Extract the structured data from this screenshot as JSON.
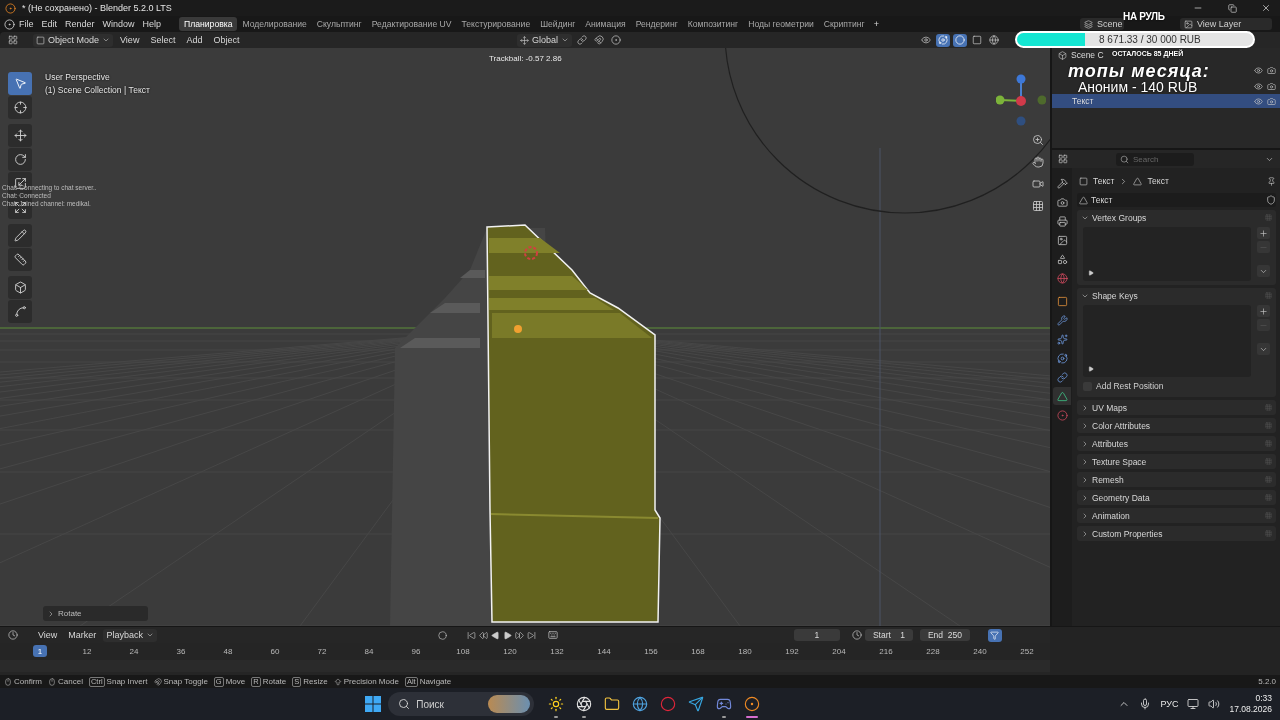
{
  "title_bar": {
    "title": "* (Не сохранено) - Blender 5.2.0 LTS"
  },
  "menu_bar": {
    "menus": [
      "File",
      "Edit",
      "Render",
      "Window",
      "Help"
    ],
    "workspaces": [
      {
        "label": "Планировка",
        "selected": true
      },
      {
        "label": "Моделирование",
        "selected": false
      },
      {
        "label": "Скульптинг",
        "selected": false
      },
      {
        "label": "Редактирование UV",
        "selected": false
      },
      {
        "label": "Текстурирование",
        "selected": false
      },
      {
        "label": "Шейдинг",
        "selected": false
      },
      {
        "label": "Анимация",
        "selected": false
      },
      {
        "label": "Рендеринг",
        "selected": false
      },
      {
        "label": "Композитинг",
        "selected": false
      },
      {
        "label": "Ноды геометрии",
        "selected": false
      },
      {
        "label": "Скриптинг",
        "selected": false
      }
    ],
    "add_tab": "+",
    "scene": "Scene",
    "view_layer": "View Layer"
  },
  "viewport_header": {
    "mode": "Object Mode",
    "menus": [
      "View",
      "Select",
      "Add",
      "Object"
    ],
    "orientation": "Global"
  },
  "viewport": {
    "tools": [
      {
        "kind": "select",
        "selected": true
      },
      {
        "kind": "cursor",
        "selected": false
      },
      {
        "kind": "move",
        "selected": false
      },
      {
        "kind": "rotate",
        "selected": false
      },
      {
        "kind": "scale",
        "selected": false
      },
      {
        "kind": "transform",
        "selected": false
      },
      {
        "kind": "annotate",
        "selected": false
      },
      {
        "kind": "measure",
        "selected": false
      },
      {
        "kind": "add-cube",
        "selected": false
      },
      {
        "kind": "curve",
        "selected": false
      }
    ],
    "view_name": "User Perspective",
    "collection_info": "(1) Scene Collection | Текст",
    "status": "Trackball: -0.57 2.86",
    "chat_log": [
      "Chat: Connecting to chat server..",
      "Chat: Connected",
      "Chat: Joined channel: medikal."
    ],
    "last_operator": "Rotate"
  },
  "outliner": {
    "header": "Scene C",
    "rows": [
      {
        "label": "Текст",
        "selected": true
      }
    ]
  },
  "stream_overlay": {
    "goal_title": "НА РУЛЬ",
    "goal_amount": "8 671.33 / 30 000 RUB",
    "level": 0.29,
    "days_left": "ОСТАЛОСЬ 85 ДНЕЙ",
    "top_title": "топы месяца:",
    "top_donor": "Аноним - 140 RUB"
  },
  "properties": {
    "search_placeholder": "Search",
    "tabs": [
      {
        "kind": "tool",
        "selected": false
      },
      {
        "kind": "render",
        "selected": false
      },
      {
        "kind": "output",
        "selected": false
      },
      {
        "kind": "view-layer",
        "selected": false
      },
      {
        "kind": "scene",
        "selected": false
      },
      {
        "kind": "world",
        "selected": false
      },
      {
        "kind": "object",
        "selected": false
      },
      {
        "kind": "modifiers",
        "selected": false
      },
      {
        "kind": "particles",
        "selected": false
      },
      {
        "kind": "physics",
        "selected": false
      },
      {
        "kind": "constraints",
        "selected": false
      },
      {
        "kind": "data",
        "selected": true
      },
      {
        "kind": "material",
        "selected": false
      }
    ],
    "breadcrumb": [
      "Текст",
      "Текст"
    ],
    "datablock": "Текст",
    "panels": [
      {
        "title": "Vertex Groups",
        "expanded": true
      },
      {
        "title": "Shape Keys",
        "expanded": true,
        "option": {
          "label": "Add Rest Position",
          "checked": false
        }
      },
      {
        "title": "UV Maps",
        "expanded": false
      },
      {
        "title": "Color Attributes",
        "expanded": false
      },
      {
        "title": "Attributes",
        "expanded": false
      },
      {
        "title": "Texture Space",
        "expanded": false
      },
      {
        "title": "Remesh",
        "expanded": false
      },
      {
        "title": "Geometry Data",
        "expanded": false
      },
      {
        "title": "Animation",
        "expanded": false
      },
      {
        "title": "Custom Properties",
        "expanded": false
      }
    ]
  },
  "timeline": {
    "menus": [
      "View",
      "Marker",
      "Playback"
    ],
    "current_frame": "1",
    "start_label": "Start",
    "start": "1",
    "end_label": "End",
    "end": "250",
    "playhead": "1",
    "ticks": [
      "12",
      "24",
      "36",
      "48",
      "60",
      "72",
      "84",
      "96",
      "108",
      "120",
      "132",
      "144",
      "156",
      "168",
      "180",
      "192",
      "204",
      "216",
      "228",
      "240",
      "252"
    ]
  },
  "status_bar": {
    "hints": [
      {
        "kind": "mouse",
        "label": "Confirm"
      },
      {
        "kind": "mouse",
        "label": "Cancel"
      },
      {
        "kind": "key",
        "key": "Ctrl",
        "label": "Snap Invert"
      },
      {
        "kind": "snap",
        "label": "Snap Toggle"
      },
      {
        "kind": "key",
        "key": "G",
        "label": "Move"
      },
      {
        "kind": "key",
        "key": "R",
        "label": "Rotate"
      },
      {
        "kind": "key",
        "key": "S",
        "label": "Resize"
      },
      {
        "kind": "shift",
        "label": "Precision Mode"
      },
      {
        "kind": "key",
        "key": "Alt",
        "label": "Navigate"
      }
    ],
    "version": "5.2.0"
  },
  "taskbar": {
    "search_placeholder": "Поиск",
    "apps": [
      {
        "kind": "sun",
        "running": true,
        "active": false
      },
      {
        "kind": "aperture",
        "running": true,
        "active": false
      },
      {
        "kind": "folder",
        "running": false,
        "active": false
      },
      {
        "kind": "globe",
        "running": false,
        "active": false
      },
      {
        "kind": "ring",
        "running": false,
        "active": false
      },
      {
        "kind": "plane",
        "running": false,
        "active": false
      },
      {
        "kind": "gamepad",
        "running": true,
        "active": false
      },
      {
        "kind": "orange-ring",
        "running": true,
        "active": true
      }
    ],
    "language": "РУС",
    "time": "0:33",
    "date": "17.08.2026"
  }
}
